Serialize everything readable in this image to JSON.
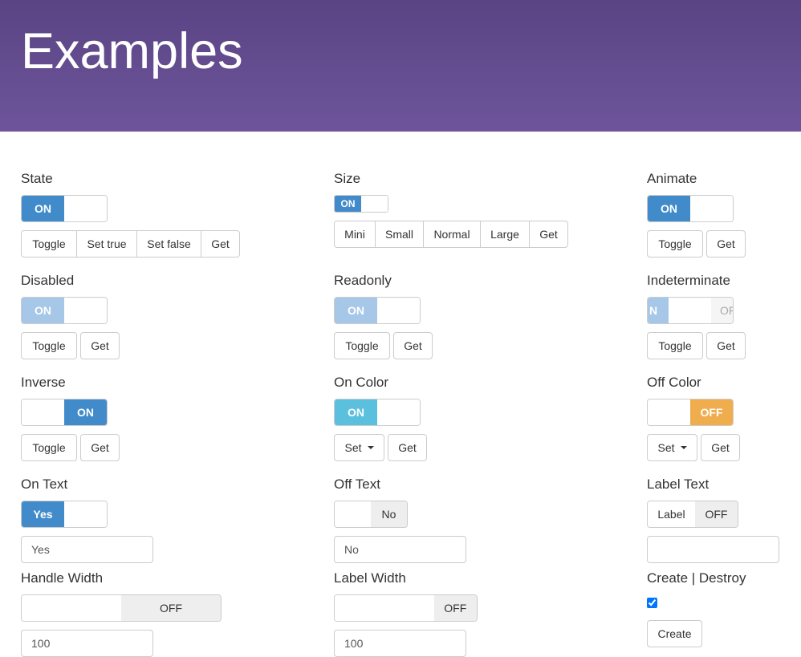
{
  "header": {
    "title": "Examples"
  },
  "colors": {
    "header": "#5e478a",
    "primary": "#428bca",
    "info": "#5bc0de",
    "warning": "#f0ad4e",
    "disabled": "#a6c7e7"
  },
  "state": {
    "title": "State",
    "switch_on": "ON",
    "buttons": [
      "Toggle",
      "Set true",
      "Set false",
      "Get"
    ]
  },
  "size": {
    "title": "Size",
    "switch_on": "ON",
    "buttons": [
      "Mini",
      "Small",
      "Normal",
      "Large",
      "Get"
    ]
  },
  "animate": {
    "title": "Animate",
    "switch_on": "ON",
    "toggle": "Toggle",
    "get": "Get"
  },
  "disabled": {
    "title": "Disabled",
    "switch_on": "ON",
    "toggle": "Toggle",
    "get": "Get"
  },
  "readonly": {
    "title": "Readonly",
    "switch_on": "ON",
    "toggle": "Toggle",
    "get": "Get"
  },
  "indeterminate": {
    "title": "Indeterminate",
    "switch_on_partial": "N",
    "switch_off_partial": "OF",
    "toggle": "Toggle",
    "get": "Get"
  },
  "inverse": {
    "title": "Inverse",
    "switch_on": "ON",
    "toggle": "Toggle",
    "get": "Get"
  },
  "on_color": {
    "title": "On Color",
    "switch_on": "ON",
    "set": "Set",
    "get": "Get"
  },
  "off_color": {
    "title": "Off Color",
    "switch_off": "OFF",
    "set": "Set",
    "get": "Get"
  },
  "on_text": {
    "title": "On Text",
    "switch_on": "Yes",
    "input_value": "Yes"
  },
  "off_text": {
    "title": "Off Text",
    "switch_off": "No",
    "input_value": "No"
  },
  "label_text": {
    "title": "Label Text",
    "switch_label": "Label",
    "switch_off": "OFF",
    "input_value": ""
  },
  "handle_width": {
    "title": "Handle Width",
    "switch_off": "OFF",
    "input_value": "100"
  },
  "label_width": {
    "title": "Label Width",
    "switch_off": "OFF",
    "input_value": "100"
  },
  "create_destroy": {
    "title": "Create | Destroy",
    "checked": true,
    "button": "Create"
  }
}
